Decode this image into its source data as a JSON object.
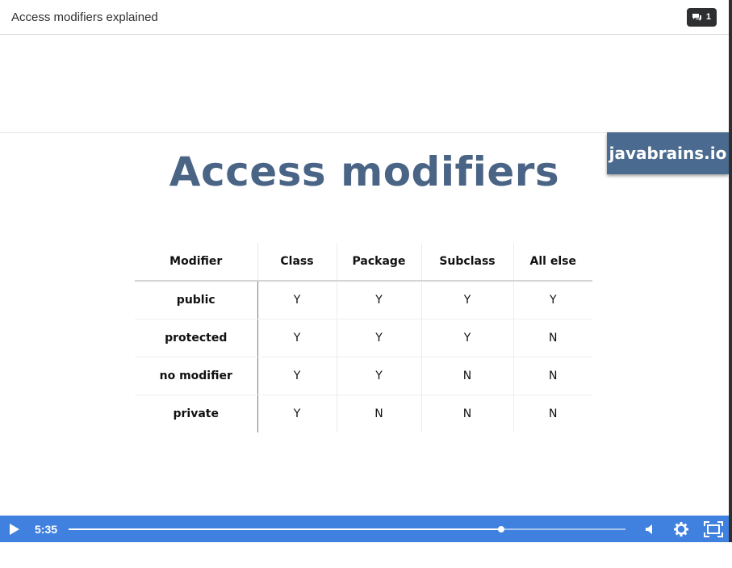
{
  "header": {
    "title": "Access modifiers explained",
    "comments_count": "1"
  },
  "slide": {
    "title": "Access modifiers",
    "watermark": "javabrains.io",
    "table": {
      "columns": [
        "Modifier",
        "Class",
        "Package",
        "Subclass",
        "All else"
      ],
      "rows": [
        [
          "public",
          "Y",
          "Y",
          "Y",
          "Y"
        ],
        [
          "protected",
          "Y",
          "Y",
          "Y",
          "N"
        ],
        [
          "no modifier",
          "Y",
          "Y",
          "N",
          "N"
        ],
        [
          "private",
          "Y",
          "N",
          "N",
          "N"
        ]
      ]
    }
  },
  "player": {
    "current_time": "5:35",
    "progress": 0.777,
    "accent_color": "#4081e0",
    "icons": [
      "play-icon",
      "volume-icon",
      "settings-gear-icon",
      "fullscreen-icon"
    ]
  },
  "colors": {
    "title_color": "#4a6486",
    "watermark_bg": "#4a6a8f",
    "badge_bg": "#2d2f31"
  }
}
